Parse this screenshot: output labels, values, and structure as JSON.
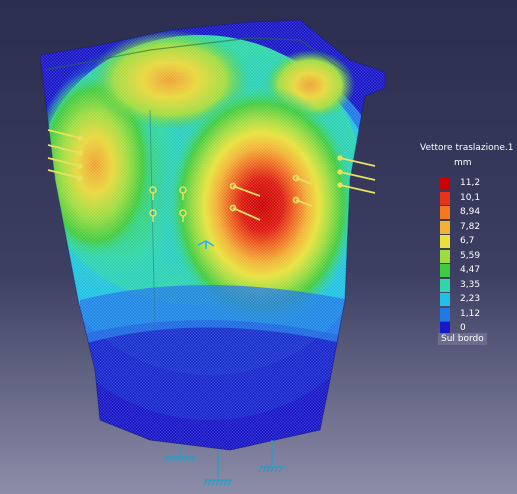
{
  "legend": {
    "title": "Vettore traslazione.1",
    "unit": "mm",
    "footer": "Sul bordo",
    "entries": [
      {
        "value": "11,2",
        "color": "#cc0000"
      },
      {
        "value": "10,1",
        "color": "#e8331a"
      },
      {
        "value": "8,94",
        "color": "#f07a1c"
      },
      {
        "value": "7,82",
        "color": "#f2b233"
      },
      {
        "value": "6,7",
        "color": "#e8e23b"
      },
      {
        "value": "5,59",
        "color": "#9fdc3f"
      },
      {
        "value": "4,47",
        "color": "#3fcb3f"
      },
      {
        "value": "3,35",
        "color": "#2fd6a7"
      },
      {
        "value": "2,23",
        "color": "#1fc1e6"
      },
      {
        "value": "1,12",
        "color": "#1f79e6"
      },
      {
        "value": "0",
        "color": "#1818c8"
      }
    ]
  },
  "colors": {
    "background_top": "#2c2e4f",
    "background_bottom": "#8c8da8"
  }
}
